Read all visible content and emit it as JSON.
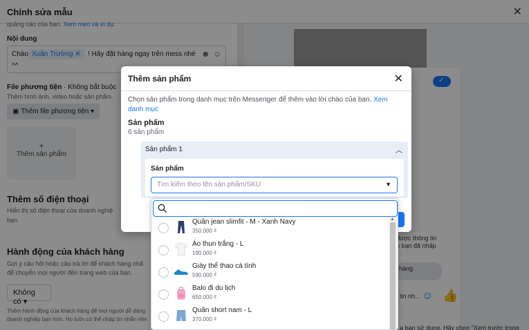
{
  "background": {
    "window_title": "Chỉnh sửa mẫu",
    "intro_snippet": "quảng cáo của bạn.",
    "intro_link": "Xem mẹo và ví dụ.",
    "content_label": "Nội dung",
    "greeting_prefix": "Chào",
    "greeting_chip": "Xuân Trường",
    "greeting_suffix": "! Hãy đặt hàng ngay trên mess nhé",
    "greeting_line2": "^^",
    "media_label": "File phương tiện",
    "media_optional": " · Không bắt buộc",
    "media_hint": "Thêm hình ảnh, video hoặc sản phẩm.",
    "add_media_button": "Thêm file phương tiện",
    "add_product_card": "Thêm sản phẩm",
    "phone_title": "Thêm số điện thoại",
    "phone_desc_1": "Hiển thị số điện thoại của doanh nghiệ",
    "phone_desc_2": "bạn.",
    "action_title": "Hành động của khách hàng",
    "action_desc_1": "Gợi ý câu hỏi hoặc câu trả lời để khách hàng nhấ",
    "action_desc_2": "để chuyển mọi người đến trang web của bạn.",
    "action_select": "Không có",
    "footer_1": "Thêm hành động của khách hàng để mọi người dễ dàng",
    "footer_2": "doanh nghiệp bạn hơn. Họ luôn có thể nhập tin nhắn riên",
    "right_text_1": "được thông tin",
    "right_text_2": "o bạn đã nhấp",
    "right_text_3": "hàng",
    "right_text_4": "tin nh...",
    "right_bottom": "ạ bạn sử dụng. Hãy chọn \"Xem trước trong"
  },
  "modal": {
    "title": "Thêm sản phẩm",
    "description": "Chọn sản phẩm trong danh mục trên Messenger để thêm vào lời chào của bạn.",
    "description_link": "Xem danh mục",
    "section_title": "Sản phẩm",
    "section_count": "6 sản phẩm",
    "accordion_title": "Sản phẩm 1",
    "field_label": "Sản phẩm",
    "select_placeholder": "Tìm kiếm theo tên sản phẩm/SKU"
  },
  "dropdown": {
    "search_value": "",
    "items": [
      {
        "name": "Quần jean slimfit - M - Xanh Navy",
        "price": "350.000 ₫",
        "icon": "jeans-icon"
      },
      {
        "name": "Áo thun trắng - L",
        "price": "190.000 ₫",
        "icon": "tshirt-icon"
      },
      {
        "name": "Giày thể thao cá tính",
        "price": "590.000 ₫",
        "icon": "sneaker-icon"
      },
      {
        "name": "Balo đi du lịch",
        "price": "650.000 ₫",
        "icon": "backpack-icon"
      },
      {
        "name": "Quần short nam - L",
        "price": "370.000 ₫",
        "icon": "shorts-icon"
      }
    ]
  },
  "colors": {
    "accent": "#1877f2",
    "overlay": "rgba(0,0,0,0.45)"
  }
}
